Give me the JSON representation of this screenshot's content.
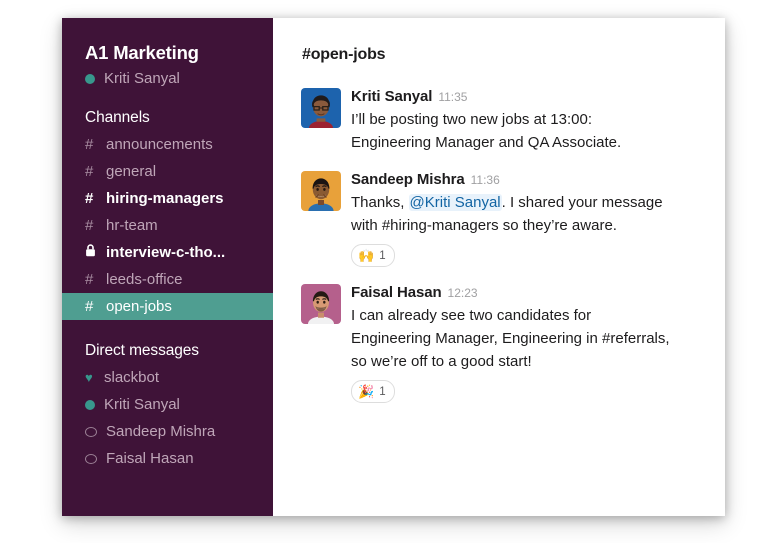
{
  "sidebar": {
    "team_name": "A1 Marketing",
    "current_user": "Kriti Sanyal",
    "current_user_presence": "online",
    "channels_heading": "Channels",
    "channels": [
      {
        "name": "announcements",
        "sigil": "#",
        "state": "read"
      },
      {
        "name": "general",
        "sigil": "#",
        "state": "read"
      },
      {
        "name": "hiring-managers",
        "sigil": "#",
        "state": "unread"
      },
      {
        "name": "hr-team",
        "sigil": "#",
        "state": "read"
      },
      {
        "name": "interview-c-tho...",
        "sigil": "lock",
        "state": "unread"
      },
      {
        "name": "leeds-office",
        "sigil": "#",
        "state": "read"
      },
      {
        "name": "open-jobs",
        "sigil": "#",
        "state": "active"
      }
    ],
    "dm_heading": "Direct messages",
    "dms": [
      {
        "name": "slackbot",
        "presence": "heart"
      },
      {
        "name": "Kriti Sanyal",
        "presence": "online"
      },
      {
        "name": "Sandeep Mishra",
        "presence": "offline"
      },
      {
        "name": "Faisal Hasan",
        "presence": "offline"
      }
    ]
  },
  "main": {
    "channel_title": "#open-jobs",
    "messages": [
      {
        "author": "Kriti Sanyal",
        "time": "11:35",
        "avatar_bg": "#1d63ad",
        "text_parts": [
          {
            "type": "text",
            "value": "I’ll be posting two new jobs at 13:00: Engineering Manager and QA Associate."
          }
        ],
        "reactions": []
      },
      {
        "author": "Sandeep Mishra",
        "time": "11:36",
        "avatar_bg": "#e8a13a",
        "text_parts": [
          {
            "type": "text",
            "value": "Thanks, "
          },
          {
            "type": "mention",
            "value": "@Kriti Sanyal"
          },
          {
            "type": "text",
            "value": ". I shared your message with #hiring-managers so they’re aware."
          }
        ],
        "reactions": [
          {
            "emoji": "🙌",
            "name": "raised-hands",
            "count": "1"
          }
        ]
      },
      {
        "author": "Faisal Hasan",
        "time": "12:23",
        "avatar_bg": "#b5608c",
        "text_parts": [
          {
            "type": "text",
            "value": "I can already see two candidates for Engineering Manager, Engineering in #referrals, so we’re off to a good start!"
          }
        ],
        "reactions": [
          {
            "emoji": "🎉",
            "name": "party-popper",
            "count": "1"
          }
        ]
      }
    ]
  },
  "colors": {
    "sidebar_bg": "#3f1338",
    "active_channel_bg": "#4f9e91",
    "mention_text": "#1264a3",
    "mention_bg": "#e8f2fb",
    "presence_online": "#38978d"
  }
}
